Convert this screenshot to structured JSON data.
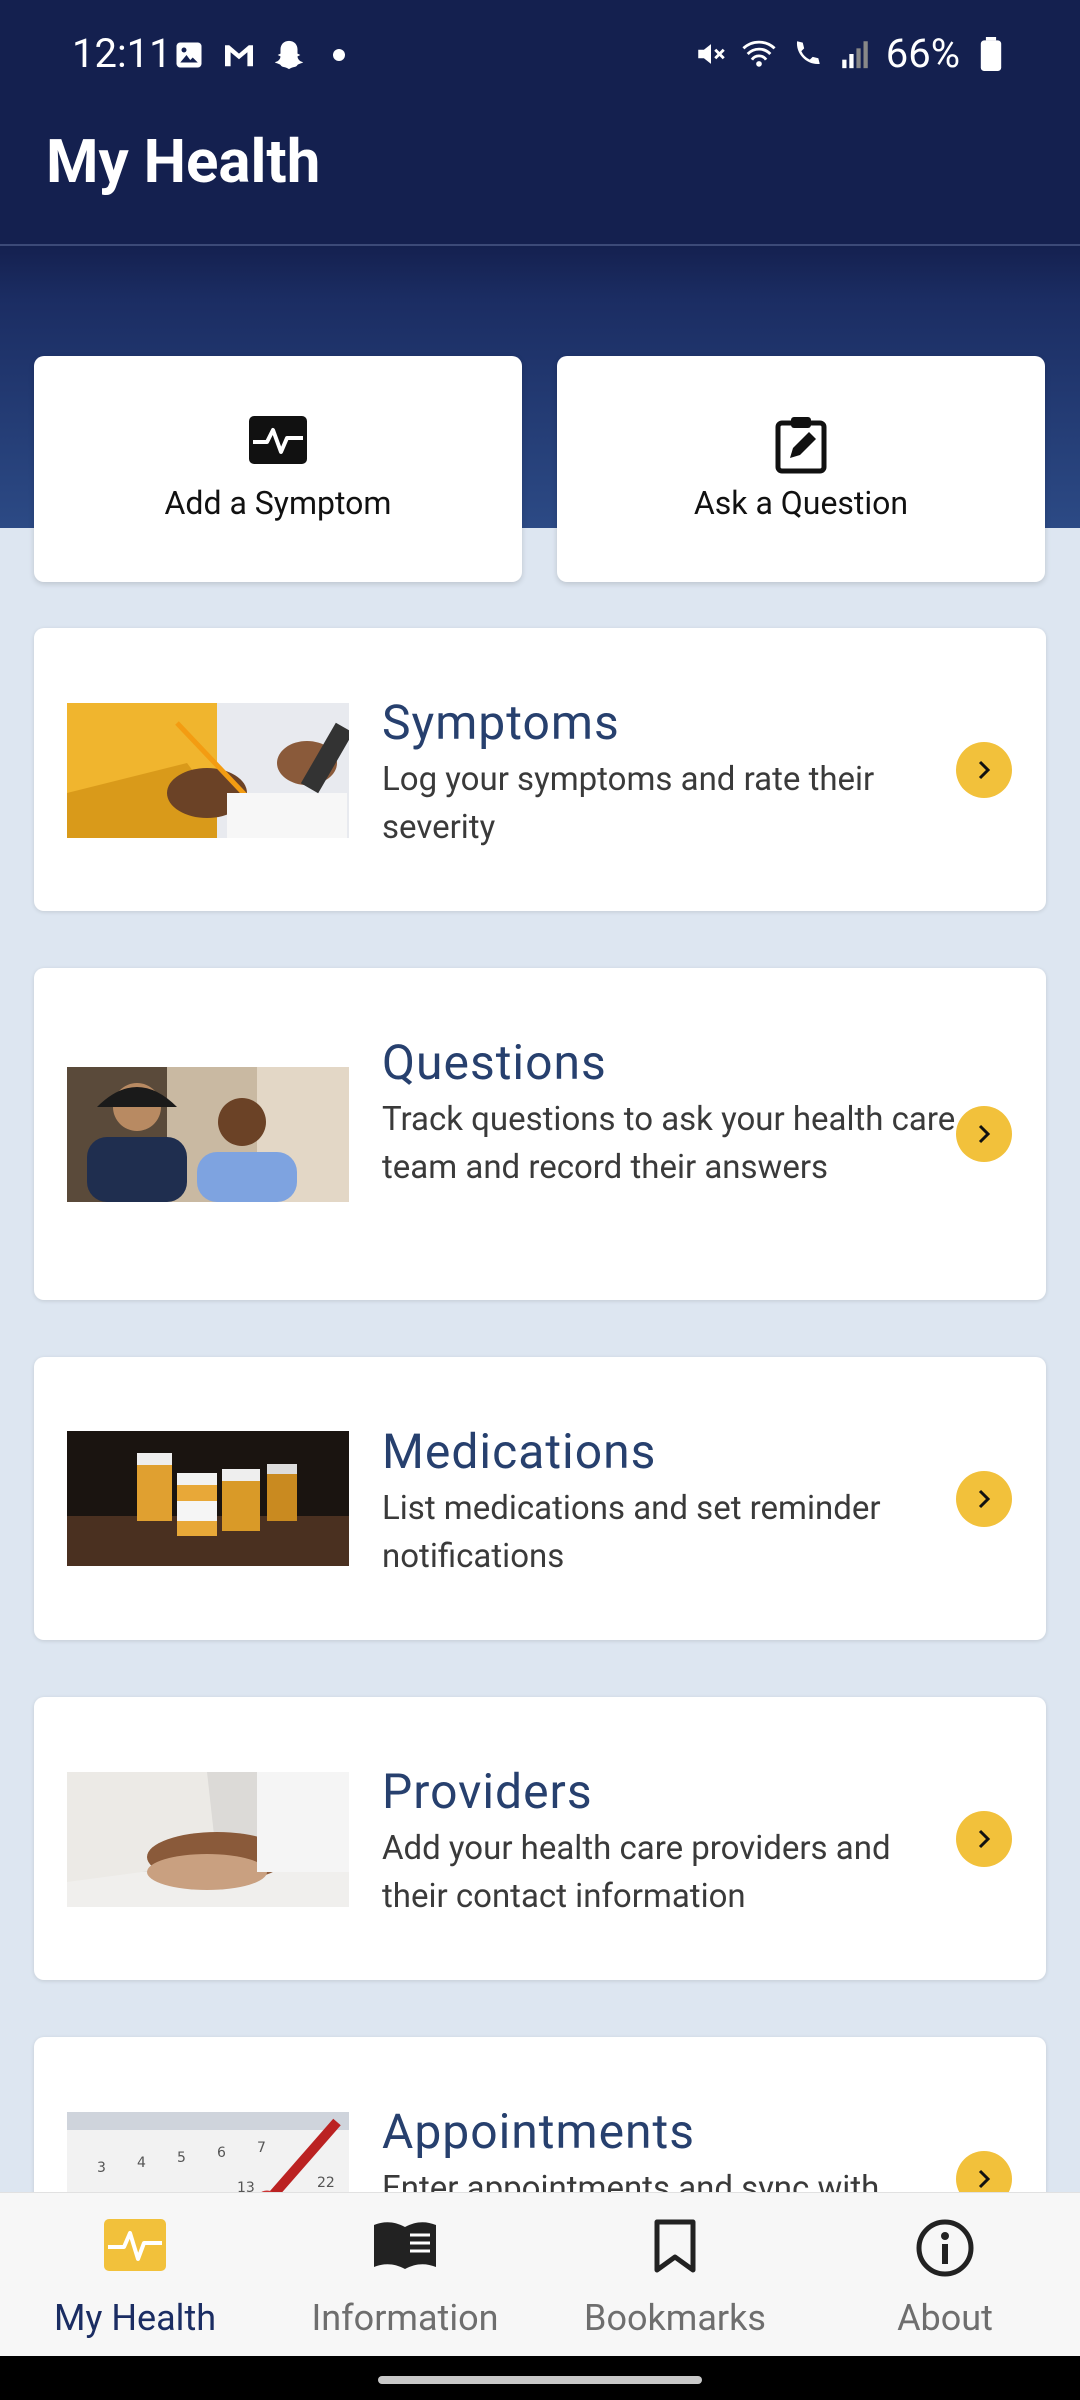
{
  "status": {
    "time": "12:11",
    "battery": "66%"
  },
  "app": {
    "title": "My Health"
  },
  "actions": [
    {
      "label": "Add a Symptom",
      "icon": "heartbeat-icon"
    },
    {
      "label": "Ask a Question",
      "icon": "clipboard-edit-icon"
    }
  ],
  "features": [
    {
      "title": "Symptoms",
      "desc": "Log your symptoms and rate their severity"
    },
    {
      "title": "Questions",
      "desc": "Track questions to ask your health care team and record their answers"
    },
    {
      "title": "Medications",
      "desc": "List medications and set reminder notifications"
    },
    {
      "title": "Providers",
      "desc": "Add your health care providers and their contact information"
    },
    {
      "title": "Appointments",
      "desc": "Enter appointments and sync with"
    }
  ],
  "nav": [
    {
      "label": "My Health",
      "icon": "heartbeat-icon",
      "active": true
    },
    {
      "label": "Information",
      "icon": "book-icon"
    },
    {
      "label": "Bookmarks",
      "icon": "bookmark-icon"
    },
    {
      "label": "About",
      "icon": "info-icon"
    }
  ],
  "colors": {
    "header": "#14204f",
    "accent": "#f2c13b",
    "title": "#27406e",
    "background": "#dde6f1"
  }
}
